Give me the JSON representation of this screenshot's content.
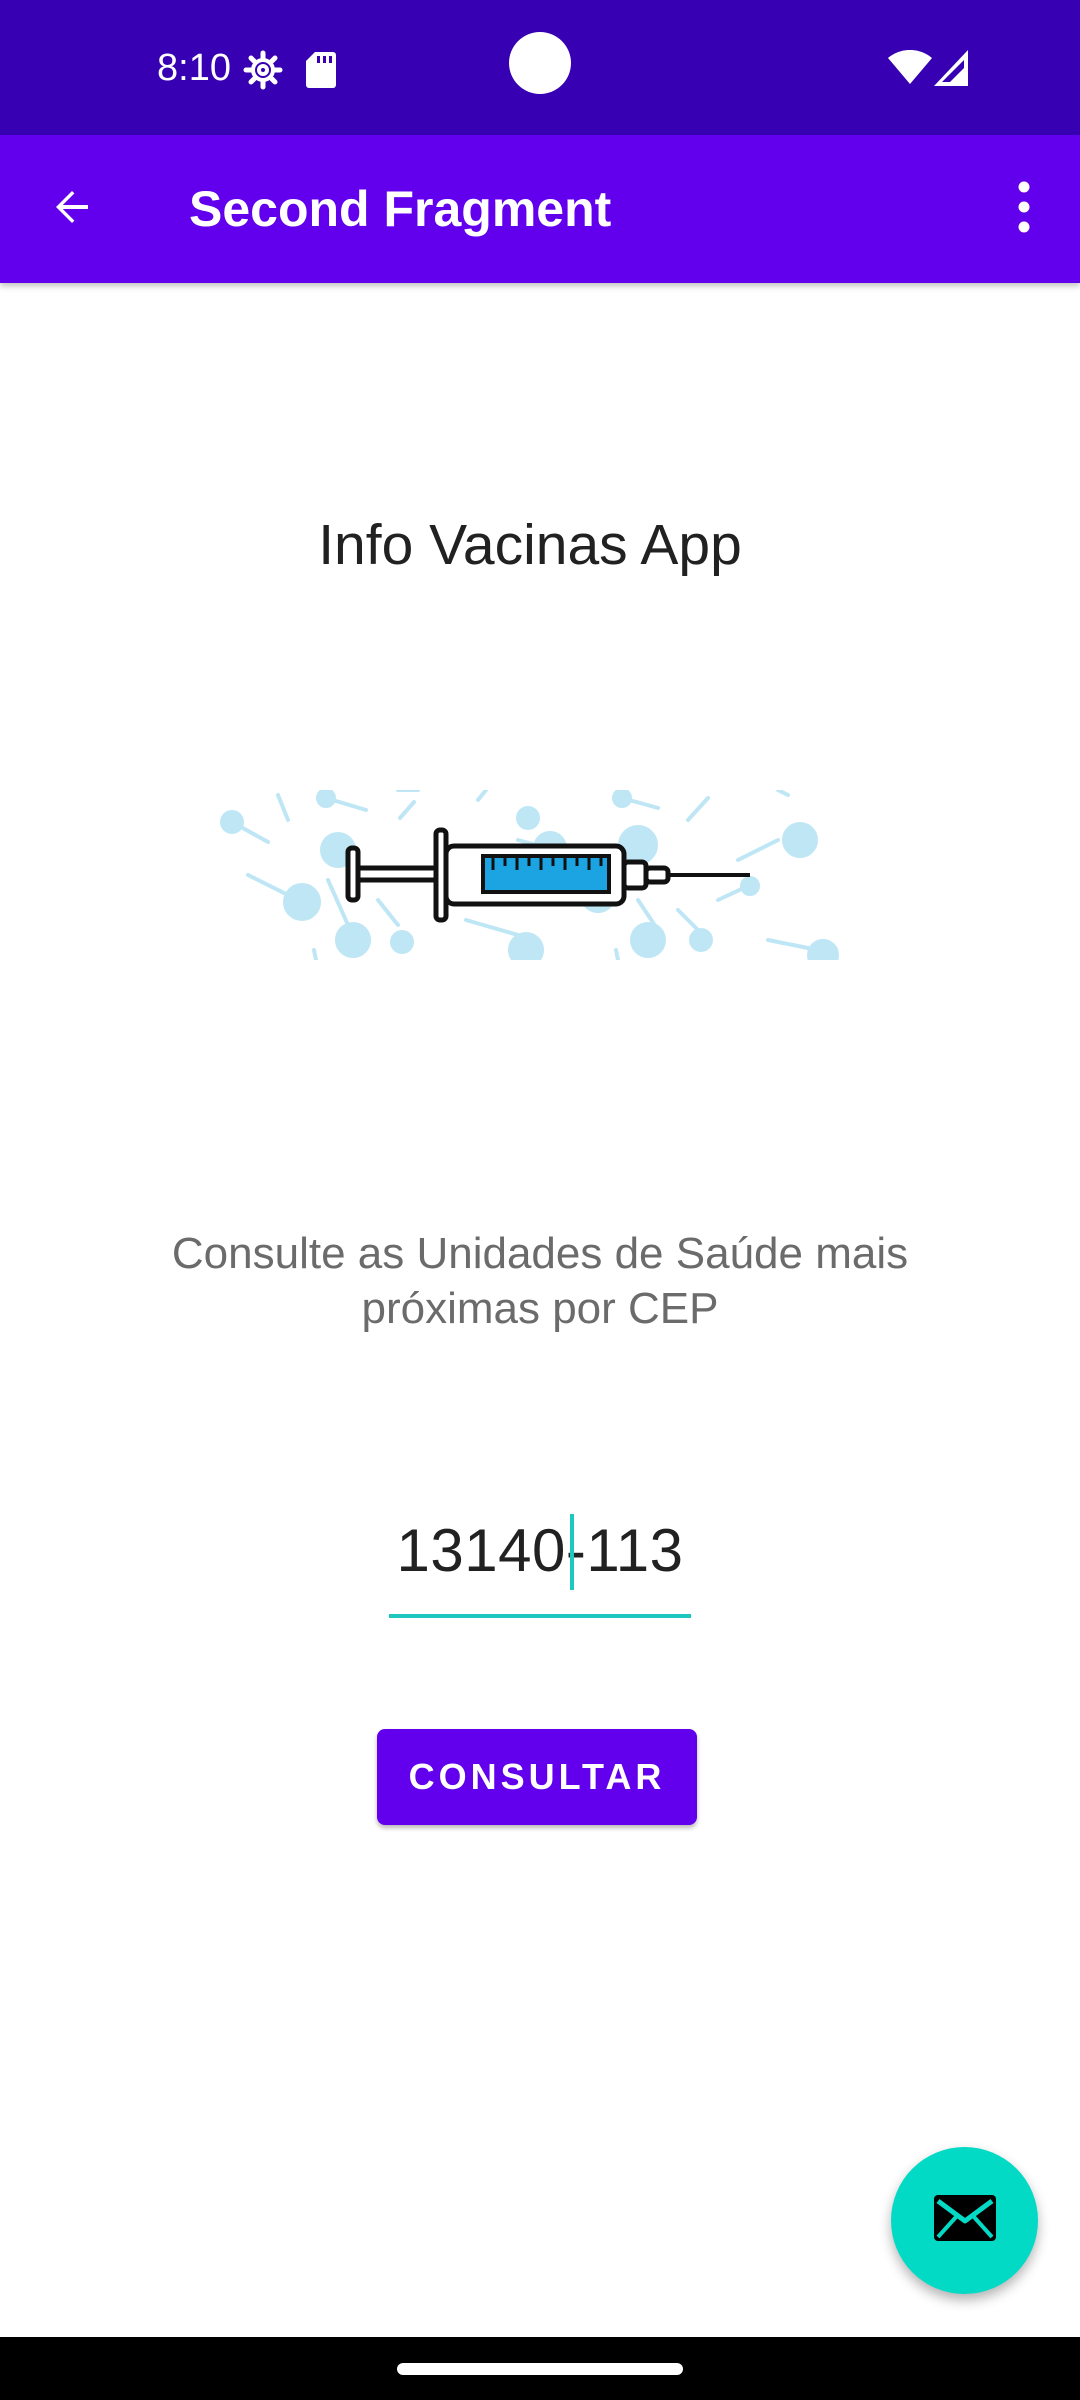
{
  "status_bar": {
    "time": "8:10",
    "icons": [
      "settings-icon",
      "sd-card-icon",
      "wifi-icon",
      "cellular-signal-icon"
    ],
    "background_color": "#3700B3"
  },
  "app_bar": {
    "title": "Second Fragment",
    "back_icon": "arrow-back-icon",
    "overflow_icon": "more-vert-icon",
    "background_color": "#6200EE"
  },
  "main": {
    "heading": "Info Vacinas App",
    "illustration": "syringe-illustration",
    "description": "Consulte as Unidades de Saúde mais próximas por CEP",
    "cep_input": {
      "value": "13140-113"
    },
    "consult_button_label": "CONSULTAR"
  },
  "fab": {
    "icon": "mail-icon",
    "background_color": "#03DAC5"
  },
  "accent_color": "#1ec8c0"
}
